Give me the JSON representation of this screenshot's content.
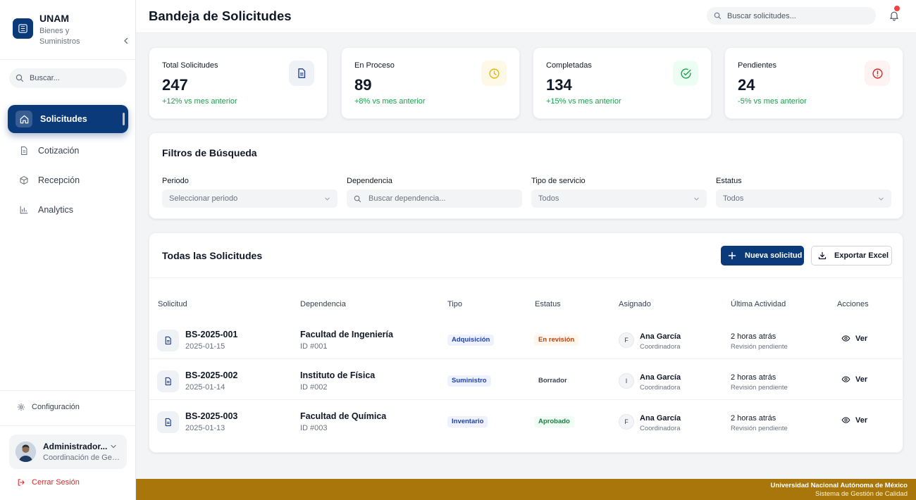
{
  "sidebar": {
    "brand_title": "UNAM",
    "brand_subtitle": "Bienes y Suministros",
    "search_placeholder": "Buscar...",
    "nav": [
      {
        "label": "Solicitudes",
        "icon": "home-icon",
        "active": true
      },
      {
        "label": "Cotización",
        "icon": "document-icon",
        "active": false
      },
      {
        "label": "Recepción",
        "icon": "box-icon",
        "active": false
      },
      {
        "label": "Analytics",
        "icon": "bar-chart-icon",
        "active": false
      }
    ],
    "config_label": "Configuración",
    "user": {
      "name": "Administrador...",
      "role": "Coordinación de Gestión"
    },
    "logout_label": "Cerrar Sesión"
  },
  "header": {
    "title": "Bandeja de Solicitudes",
    "search_placeholder": "Buscar solicitudes..."
  },
  "stats": [
    {
      "label": "Total Solicitudes",
      "value": "247",
      "delta": "+12% vs mes anterior",
      "icon": "document-icon",
      "color": "#1e3a8a",
      "bg": "#eef2f7"
    },
    {
      "label": "En Proceso",
      "value": "89",
      "delta": "+8% vs mes anterior",
      "icon": "clock-icon",
      "color": "#eab308",
      "bg": "#fef9e7"
    },
    {
      "label": "Completadas",
      "value": "134",
      "delta": "+15% vs mes anterior",
      "icon": "check-circle-icon",
      "color": "#16a34a",
      "bg": "#ecfdf3"
    },
    {
      "label": "Pendientes",
      "value": "24",
      "delta": "-5% vs mes anterior",
      "icon": "alert-circle-icon",
      "color": "#dc2626",
      "bg": "#fef2f2"
    }
  ],
  "filters": {
    "title": "Filtros de Búsqueda",
    "periodo_label": "Periodo",
    "periodo_value": "Seleccionar periodo",
    "dependencia_label": "Dependencia",
    "dependencia_placeholder": "Buscar dependencia...",
    "tipo_label": "Tipo de servicio",
    "tipo_value": "Todos",
    "estatus_label": "Estatus",
    "estatus_value": "Todos"
  },
  "table": {
    "title": "Todas las Solicitudes",
    "new_button": "Nueva solicitud",
    "export_button": "Exportar Excel",
    "columns": [
      "Solicitud",
      "Dependencia",
      "Tipo",
      "Estatus",
      "Asignado",
      "Última Actividad",
      "Acciones"
    ],
    "rows": [
      {
        "id": "BS-2025-001",
        "date": "2025-01-15",
        "dep": "Facultad de Ingeniería",
        "dep_id": "ID #001",
        "tipo": "Adquisición",
        "estatus": "En revisión",
        "status_class": "st-rev",
        "initial": "F",
        "assignee": "Ana García",
        "assignee_role": "Coordinadora",
        "time": "2 horas atrás",
        "activity": "Revisión pendiente",
        "action": "Ver"
      },
      {
        "id": "BS-2025-002",
        "date": "2025-01-14",
        "dep": "Instituto de Física",
        "dep_id": "ID #002",
        "tipo": "Suministro",
        "estatus": "Borrador",
        "status_class": "st-bor",
        "initial": "I",
        "assignee": "Ana García",
        "assignee_role": "Coordinadora",
        "time": "2 horas atrás",
        "activity": "Revisión pendiente",
        "action": "Ver"
      },
      {
        "id": "BS-2025-003",
        "date": "2025-01-13",
        "dep": "Facultad de Química",
        "dep_id": "ID #003",
        "tipo": "Inventario",
        "estatus": "Aprobado",
        "status_class": "st-apr",
        "initial": "F",
        "assignee": "Ana García",
        "assignee_role": "Coordinadora",
        "time": "2 horas atrás",
        "activity": "Revisión pendiente",
        "action": "Ver"
      }
    ]
  },
  "footer": {
    "line1": "Universidad Nacional Autónoma de México",
    "line2": "Sistema de Gestión de Calidad"
  },
  "colors": {
    "primary": "#0b3a7a",
    "footer": "#a8760a",
    "positive": "#16a34a",
    "danger": "#dc2626"
  }
}
